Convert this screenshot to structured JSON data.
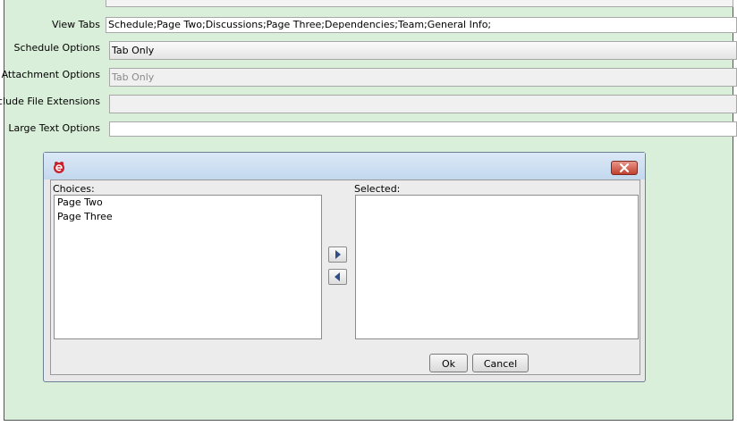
{
  "form": {
    "rows": [
      {
        "label": "View Tabs",
        "value": "Schedule;Page Two;Discussions;Page Three;Dependencies;Team;General Info;"
      },
      {
        "label": "Schedule Options",
        "value": "Tab Only"
      },
      {
        "label": "Attachment Options",
        "value": "Tab Only"
      },
      {
        "label": "Include File Extensions",
        "value": ""
      },
      {
        "label": "Large Text Options",
        "value": ""
      }
    ]
  },
  "dialog": {
    "choices_label": "Choices:",
    "selected_label": "Selected:",
    "choices": [
      "Page Two",
      "Page Three"
    ],
    "selected": [],
    "ok_label": "Ok",
    "cancel_label": "Cancel"
  },
  "colors": {
    "panel_background": "#d9efda",
    "close_button": "#c2402f"
  }
}
